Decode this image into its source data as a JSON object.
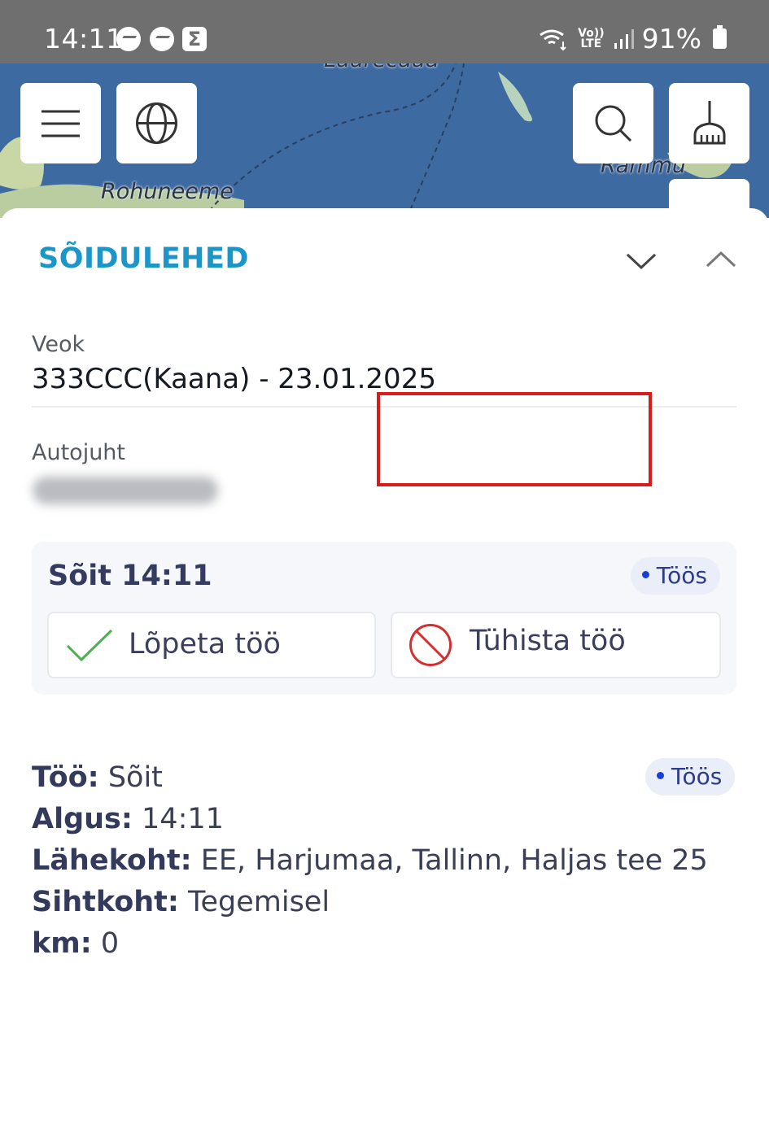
{
  "status_bar": {
    "time": "14:11",
    "volte_line1": "Vo))",
    "volte_line2": "LTE",
    "battery_percent": "91%",
    "notifications": [
      "messenger-icon",
      "messenger-icon",
      "sigma-icon"
    ]
  },
  "map": {
    "labels": {
      "top": "Luarecaua",
      "left": "Rohuneeme",
      "right": "Rammu"
    }
  },
  "sheet": {
    "title": "SÕIDULEHED",
    "vehicle_label": "Veok",
    "vehicle_value": "333CCC(Kaana) - 23.01.2025",
    "driver_label": "Autojuht",
    "trip_card": {
      "title": "Sõit 14:11",
      "status_badge": "Töös",
      "finish_button": "Lõpeta töö",
      "cancel_button": "Tühista töö"
    },
    "details": {
      "status_badge": "Töös",
      "job_label": "Töö:",
      "job_value": "Sõit",
      "start_label": "Algus:",
      "start_value": "14:11",
      "origin_label": "Lähekoht:",
      "origin_value": "EE, Harjumaa, Tallinn, Haljas tee 25",
      "destination_label": "Sihtkoht:",
      "destination_value": "Tegemisel",
      "km_label": "km:",
      "km_value": "0"
    }
  },
  "colors": {
    "accent": "#1c95c9",
    "highlight": "#d81b1b",
    "check": "#4caf50",
    "cancel": "#d32f2f",
    "badge_dot": "#1740d6"
  }
}
